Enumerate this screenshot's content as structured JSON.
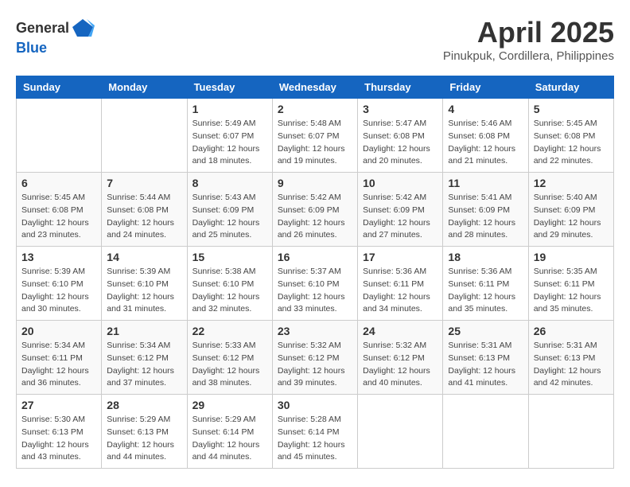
{
  "header": {
    "logo_general": "General",
    "logo_blue": "Blue",
    "month_year": "April 2025",
    "location": "Pinukpuk, Cordillera, Philippines"
  },
  "calendar": {
    "days_of_week": [
      "Sunday",
      "Monday",
      "Tuesday",
      "Wednesday",
      "Thursday",
      "Friday",
      "Saturday"
    ],
    "weeks": [
      [
        {
          "day": "",
          "detail": ""
        },
        {
          "day": "",
          "detail": ""
        },
        {
          "day": "1",
          "detail": "Sunrise: 5:49 AM\nSunset: 6:07 PM\nDaylight: 12 hours\nand 18 minutes."
        },
        {
          "day": "2",
          "detail": "Sunrise: 5:48 AM\nSunset: 6:07 PM\nDaylight: 12 hours\nand 19 minutes."
        },
        {
          "day": "3",
          "detail": "Sunrise: 5:47 AM\nSunset: 6:08 PM\nDaylight: 12 hours\nand 20 minutes."
        },
        {
          "day": "4",
          "detail": "Sunrise: 5:46 AM\nSunset: 6:08 PM\nDaylight: 12 hours\nand 21 minutes."
        },
        {
          "day": "5",
          "detail": "Sunrise: 5:45 AM\nSunset: 6:08 PM\nDaylight: 12 hours\nand 22 minutes."
        }
      ],
      [
        {
          "day": "6",
          "detail": "Sunrise: 5:45 AM\nSunset: 6:08 PM\nDaylight: 12 hours\nand 23 minutes."
        },
        {
          "day": "7",
          "detail": "Sunrise: 5:44 AM\nSunset: 6:08 PM\nDaylight: 12 hours\nand 24 minutes."
        },
        {
          "day": "8",
          "detail": "Sunrise: 5:43 AM\nSunset: 6:09 PM\nDaylight: 12 hours\nand 25 minutes."
        },
        {
          "day": "9",
          "detail": "Sunrise: 5:42 AM\nSunset: 6:09 PM\nDaylight: 12 hours\nand 26 minutes."
        },
        {
          "day": "10",
          "detail": "Sunrise: 5:42 AM\nSunset: 6:09 PM\nDaylight: 12 hours\nand 27 minutes."
        },
        {
          "day": "11",
          "detail": "Sunrise: 5:41 AM\nSunset: 6:09 PM\nDaylight: 12 hours\nand 28 minutes."
        },
        {
          "day": "12",
          "detail": "Sunrise: 5:40 AM\nSunset: 6:09 PM\nDaylight: 12 hours\nand 29 minutes."
        }
      ],
      [
        {
          "day": "13",
          "detail": "Sunrise: 5:39 AM\nSunset: 6:10 PM\nDaylight: 12 hours\nand 30 minutes."
        },
        {
          "day": "14",
          "detail": "Sunrise: 5:39 AM\nSunset: 6:10 PM\nDaylight: 12 hours\nand 31 minutes."
        },
        {
          "day": "15",
          "detail": "Sunrise: 5:38 AM\nSunset: 6:10 PM\nDaylight: 12 hours\nand 32 minutes."
        },
        {
          "day": "16",
          "detail": "Sunrise: 5:37 AM\nSunset: 6:10 PM\nDaylight: 12 hours\nand 33 minutes."
        },
        {
          "day": "17",
          "detail": "Sunrise: 5:36 AM\nSunset: 6:11 PM\nDaylight: 12 hours\nand 34 minutes."
        },
        {
          "day": "18",
          "detail": "Sunrise: 5:36 AM\nSunset: 6:11 PM\nDaylight: 12 hours\nand 35 minutes."
        },
        {
          "day": "19",
          "detail": "Sunrise: 5:35 AM\nSunset: 6:11 PM\nDaylight: 12 hours\nand 35 minutes."
        }
      ],
      [
        {
          "day": "20",
          "detail": "Sunrise: 5:34 AM\nSunset: 6:11 PM\nDaylight: 12 hours\nand 36 minutes."
        },
        {
          "day": "21",
          "detail": "Sunrise: 5:34 AM\nSunset: 6:12 PM\nDaylight: 12 hours\nand 37 minutes."
        },
        {
          "day": "22",
          "detail": "Sunrise: 5:33 AM\nSunset: 6:12 PM\nDaylight: 12 hours\nand 38 minutes."
        },
        {
          "day": "23",
          "detail": "Sunrise: 5:32 AM\nSunset: 6:12 PM\nDaylight: 12 hours\nand 39 minutes."
        },
        {
          "day": "24",
          "detail": "Sunrise: 5:32 AM\nSunset: 6:12 PM\nDaylight: 12 hours\nand 40 minutes."
        },
        {
          "day": "25",
          "detail": "Sunrise: 5:31 AM\nSunset: 6:13 PM\nDaylight: 12 hours\nand 41 minutes."
        },
        {
          "day": "26",
          "detail": "Sunrise: 5:31 AM\nSunset: 6:13 PM\nDaylight: 12 hours\nand 42 minutes."
        }
      ],
      [
        {
          "day": "27",
          "detail": "Sunrise: 5:30 AM\nSunset: 6:13 PM\nDaylight: 12 hours\nand 43 minutes."
        },
        {
          "day": "28",
          "detail": "Sunrise: 5:29 AM\nSunset: 6:13 PM\nDaylight: 12 hours\nand 44 minutes."
        },
        {
          "day": "29",
          "detail": "Sunrise: 5:29 AM\nSunset: 6:14 PM\nDaylight: 12 hours\nand 44 minutes."
        },
        {
          "day": "30",
          "detail": "Sunrise: 5:28 AM\nSunset: 6:14 PM\nDaylight: 12 hours\nand 45 minutes."
        },
        {
          "day": "",
          "detail": ""
        },
        {
          "day": "",
          "detail": ""
        },
        {
          "day": "",
          "detail": ""
        }
      ]
    ]
  }
}
